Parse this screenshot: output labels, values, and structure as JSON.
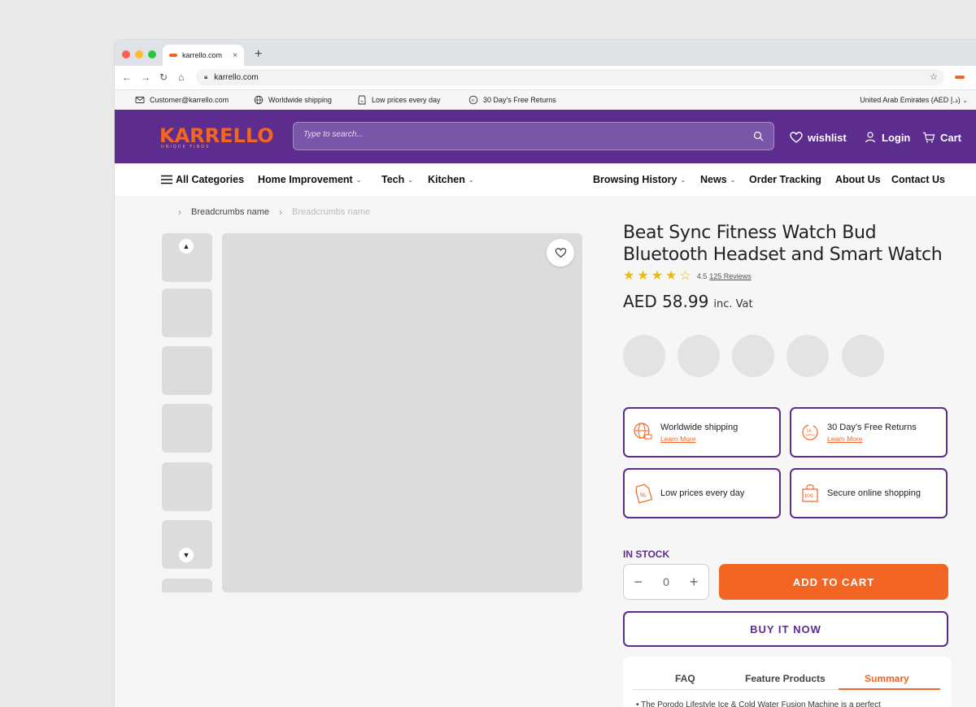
{
  "browser": {
    "tab_title": "karrello.com",
    "tab_close": "×",
    "new_tab": "+",
    "url": "karrello.com",
    "star": "☆"
  },
  "infobar": {
    "email": "Customer@karrello.com",
    "shipping": "Worldwide shipping",
    "low_prices": "Low prices every day",
    "returns": "30 Day's Free Returns",
    "region": "United Arab Emirates (AED د.إ)"
  },
  "header": {
    "logo": "KARRELLO",
    "logo_tagline": "UNIQUE FINDS",
    "search_placeholder": "Type to search...",
    "wishlist": "wishlist",
    "login": "Login",
    "cart": "Cart"
  },
  "catnav": {
    "all_categories": "All Categories",
    "left": [
      "Home Improvement",
      "Tech",
      "Kitchen"
    ],
    "browsing_history": "Browsing History",
    "news": "News",
    "order_tracking": "Order Tracking",
    "about": "About Us",
    "contact": "Contact Us"
  },
  "breadcrumbs": [
    "Breadcrumbs name",
    "Breadcrumbs name"
  ],
  "product": {
    "title": "Beat Sync Fitness Watch Bud Bluetooth Headset and Smart Watch",
    "rating_value": "4.5",
    "rating_stars": 4.5,
    "reviews": "125 Reviews",
    "price": "AED 58.99",
    "vat": "inc. Vat",
    "stock": "IN STOCK",
    "quantity": "0",
    "add_to_cart": "ADD TO CART",
    "buy_now": "BUY IT NOW"
  },
  "features": {
    "shipping": "Worldwide shipping",
    "returns": "30 Day's Free Returns",
    "learn_more": "Learn More",
    "low_prices": "Low prices every day",
    "secure": "Secure online shopping"
  },
  "tabs": {
    "faq": "FAQ",
    "feature_products": "Feature Products",
    "summary": "Summary",
    "summary_text": "• The Porodo Lifestyle Ice & Cold Water Fusion Machine is a perfect"
  },
  "colors": {
    "brand_purple": "#5c2d8e",
    "brand_orange": "#f26522",
    "star": "#f5b800"
  }
}
